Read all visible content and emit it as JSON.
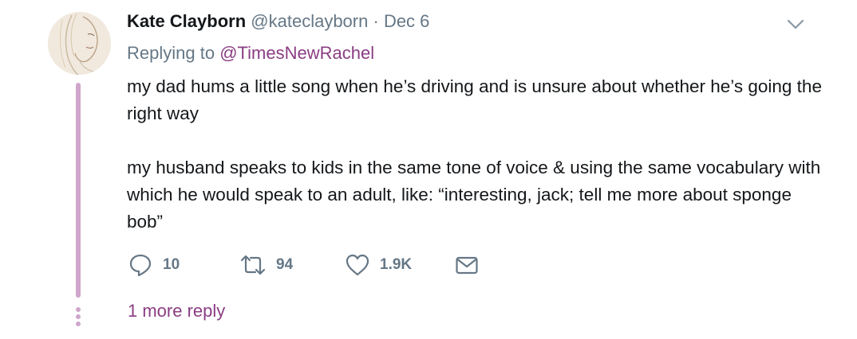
{
  "tweet": {
    "author_name": "Kate Clayborn",
    "handle": "@kateclayborn",
    "separator": "·",
    "date": "Dec 6",
    "replying_prefix": "Replying to",
    "replying_to": "@TimesNewRachel",
    "paragraphs": [
      "my dad hums a little song when he’s driving and is unsure about whether he’s going the right way",
      "my husband speaks to kids in the same tone of voice & using the same vocabulary with which he would speak to an adult, like: “interesting, jack; tell me more about sponge bob”"
    ],
    "actions": {
      "reply_count": "10",
      "retweet_count": "94",
      "like_count": "1.9K"
    },
    "more_replies": "1 more reply"
  },
  "icons": {
    "avatar": "sketch-portrait-avatar",
    "menu": "chevron-down-icon",
    "reply": "reply-icon",
    "retweet": "retweet-icon",
    "like": "heart-icon",
    "dm": "envelope-icon"
  },
  "colors": {
    "link": "#8b3d83",
    "muted": "#657786",
    "text": "#14171a",
    "thread_line": "#cfa6cc"
  }
}
